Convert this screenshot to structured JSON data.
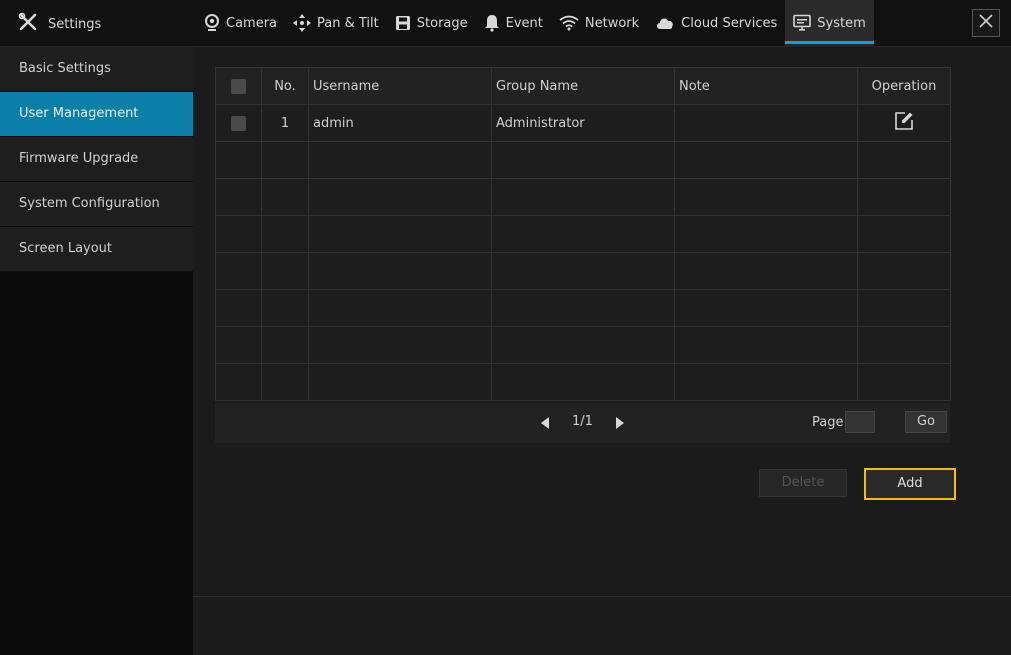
{
  "header": {
    "app_title": "Settings",
    "tabs": [
      {
        "label": "Camera",
        "icon": "camera-icon"
      },
      {
        "label": "Pan & Tilt",
        "icon": "pan-tilt-icon"
      },
      {
        "label": "Storage",
        "icon": "storage-icon"
      },
      {
        "label": "Event",
        "icon": "bell-icon"
      },
      {
        "label": "Network",
        "icon": "wifi-icon"
      },
      {
        "label": "Cloud Services",
        "icon": "cloud-icon"
      },
      {
        "label": "System",
        "icon": "monitor-icon",
        "active": true
      }
    ]
  },
  "sidebar": {
    "items": [
      {
        "label": "Basic Settings"
      },
      {
        "label": "User Management",
        "active": true
      },
      {
        "label": "Firmware Upgrade"
      },
      {
        "label": "System Configuration"
      },
      {
        "label": "Screen Layout"
      }
    ]
  },
  "table": {
    "columns": {
      "no": "No.",
      "username": "Username",
      "group": "Group Name",
      "note": "Note",
      "operation": "Operation"
    },
    "rows": [
      {
        "no": "1",
        "username": "admin",
        "group": "Administrator",
        "note": ""
      }
    ]
  },
  "pagination": {
    "page_display": "1/1",
    "page_label": "Page",
    "page_input_value": "",
    "go_label": "Go"
  },
  "actions": {
    "delete_label": "Delete",
    "add_label": "Add"
  },
  "colors": {
    "accent": "#0b7fa8",
    "tab_underline": "#1a9cd8",
    "focus_outline": "#f2c200"
  }
}
